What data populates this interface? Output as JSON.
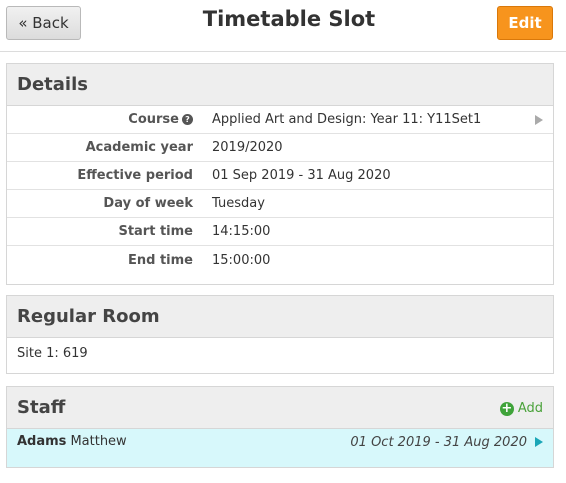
{
  "header": {
    "back_label": "« Back",
    "title": "Timetable Slot",
    "edit_label": "Edit"
  },
  "details": {
    "heading": "Details",
    "rows": [
      {
        "label": "Course",
        "value": "Applied Art and Design: Year 11: Y11Set1",
        "help": "?"
      },
      {
        "label": "Academic year",
        "value": "2019/2020"
      },
      {
        "label": "Effective period",
        "value": "01 Sep 2019 - 31 Aug 2020"
      },
      {
        "label": "Day of week",
        "value": "Tuesday"
      },
      {
        "label": "Start time",
        "value": "14:15:00"
      },
      {
        "label": "End time",
        "value": "15:00:00"
      }
    ]
  },
  "room": {
    "heading": "Regular Room",
    "value": "Site 1: 619"
  },
  "staff": {
    "heading": "Staff",
    "add_label": "Add",
    "add_icon": "+",
    "members": [
      {
        "surname": "Adams",
        "forename": "Matthew",
        "period": "01 Oct 2019 - 31 Aug 2020"
      }
    ]
  },
  "colors": {
    "edit_button": "#f7941d",
    "add_link": "#4aa23a",
    "staff_row_bg": "#d7f8fb",
    "staff_arrow": "#1aa6b7"
  }
}
